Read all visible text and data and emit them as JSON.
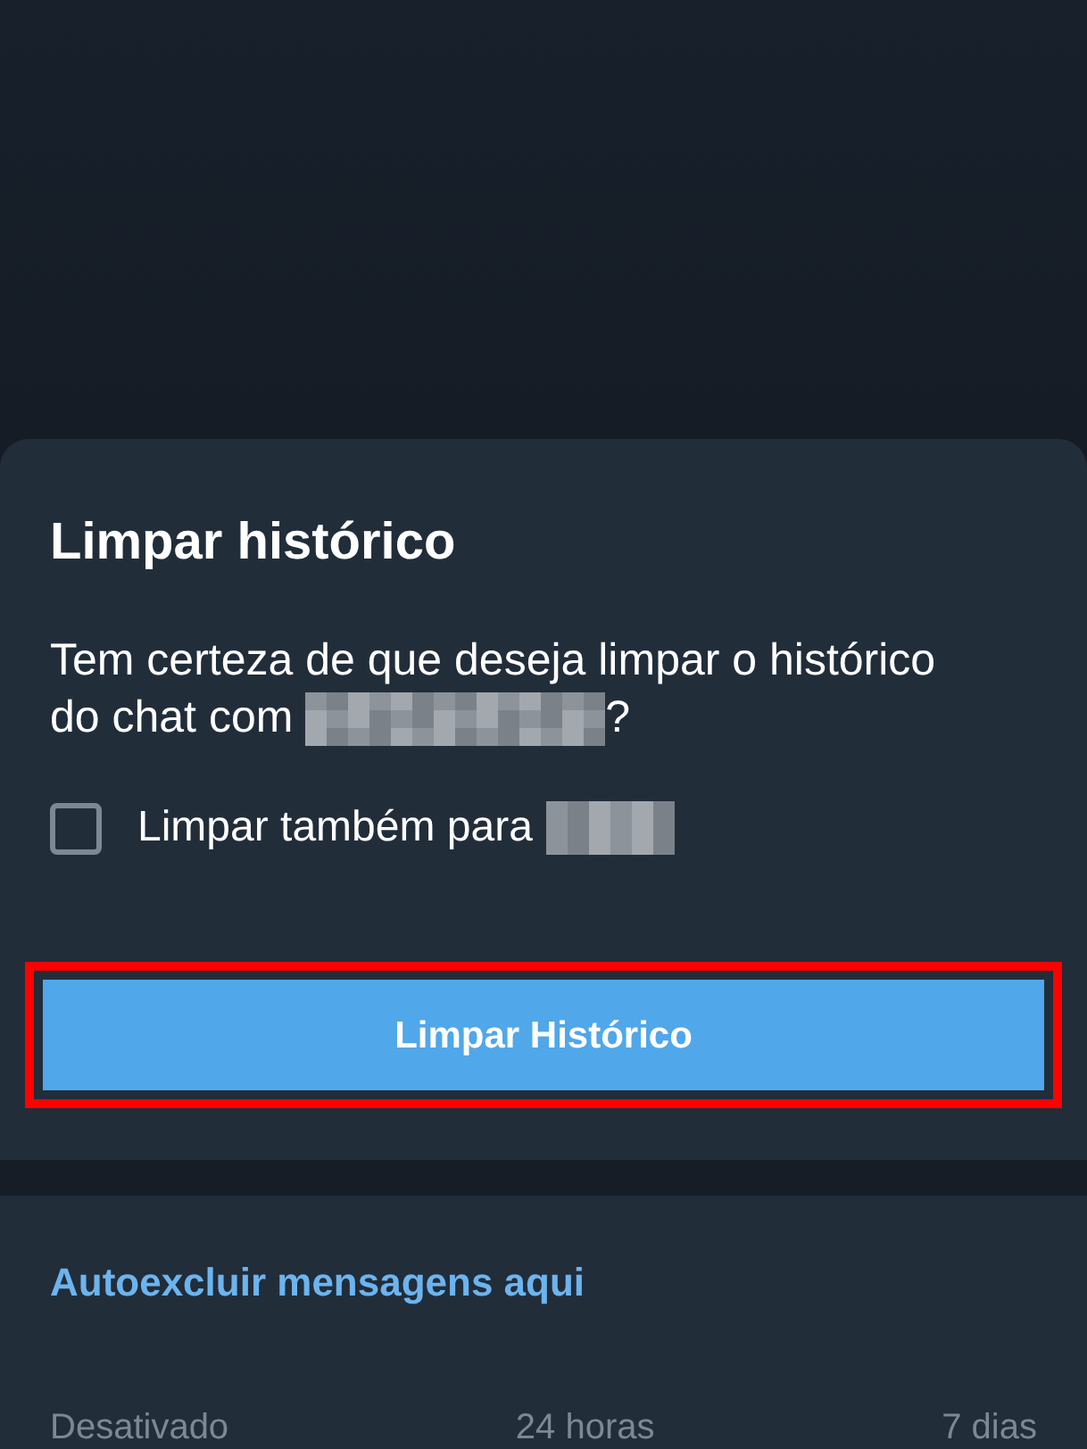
{
  "dialog": {
    "title": "Limpar histórico",
    "message_start": "Tem certeza de que deseja limpar o histórico do chat com",
    "message_end": "?",
    "checkbox": {
      "label": "Limpar também para",
      "checked": false
    },
    "button": {
      "label": "Limpar Histórico",
      "highlighted": true
    }
  },
  "auto_delete": {
    "title": "Autoexcluir mensagens aqui",
    "options": [
      {
        "label": "Desativado"
      },
      {
        "label": "24 horas"
      },
      {
        "label": "7 dias"
      }
    ]
  }
}
